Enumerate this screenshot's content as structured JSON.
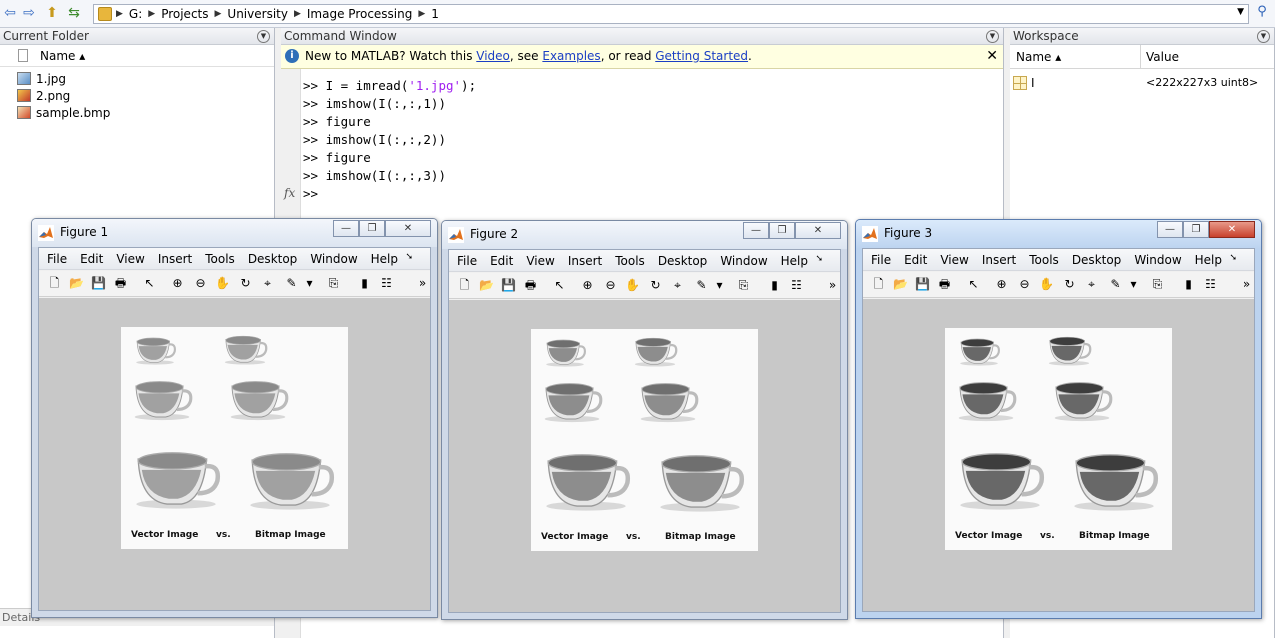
{
  "address": {
    "segments": [
      "G:",
      "Projects",
      "University",
      "Image Processing",
      "1"
    ]
  },
  "current_folder": {
    "title": "Current Folder",
    "column_name": "Name ▴",
    "files": [
      {
        "name": "1.jpg",
        "icon": "jpg-file-icon"
      },
      {
        "name": "2.png",
        "icon": "png-file-icon"
      },
      {
        "name": "sample.bmp",
        "icon": "bmp-file-icon"
      }
    ],
    "details_label": "Details"
  },
  "command_window": {
    "title": "Command Window",
    "banner": {
      "prefix": "New to MATLAB? Watch this ",
      "video": "Video",
      "mid1": ", see ",
      "examples": "Examples",
      "mid2": ", or read ",
      "getting_started": "Getting Started",
      "suffix": ".",
      "close": "✕"
    },
    "lines": [
      {
        "pre": ">> I = imread(",
        "str": "'1.jpg'",
        "post": ");"
      },
      {
        "pre": ">> imshow(I(:,:,1))",
        "str": "",
        "post": ""
      },
      {
        "pre": ">> figure",
        "str": "",
        "post": ""
      },
      {
        "pre": ">> imshow(I(:,:,2))",
        "str": "",
        "post": ""
      },
      {
        "pre": ">> figure",
        "str": "",
        "post": ""
      },
      {
        "pre": ">> imshow(I(:,:,3))",
        "str": "",
        "post": ""
      },
      {
        "pre": ">> ",
        "str": "",
        "post": ""
      }
    ],
    "fx": "fx"
  },
  "workspace": {
    "title": "Workspace",
    "col_name": "Name ▴",
    "col_value": "Value",
    "vars": [
      {
        "name": "I",
        "value": "<222x227x3 uint8>"
      }
    ]
  },
  "figures": [
    {
      "title": "Figure 1",
      "active": false,
      "cup_tone": "#8a8a8a"
    },
    {
      "title": "Figure 2",
      "active": false,
      "cup_tone": "#6f6f6f"
    },
    {
      "title": "Figure 3",
      "active": true,
      "cup_tone": "#3d3d3d"
    }
  ],
  "figure_menu": [
    "File",
    "Edit",
    "View",
    "Insert",
    "Tools",
    "Desktop",
    "Window",
    "Help"
  ],
  "figure_caption": {
    "left": "Vector Image",
    "mid": "vs.",
    "right": "Bitmap Image"
  },
  "window_buttons": {
    "minimize": "—",
    "restore": "❐",
    "close": "✕"
  }
}
